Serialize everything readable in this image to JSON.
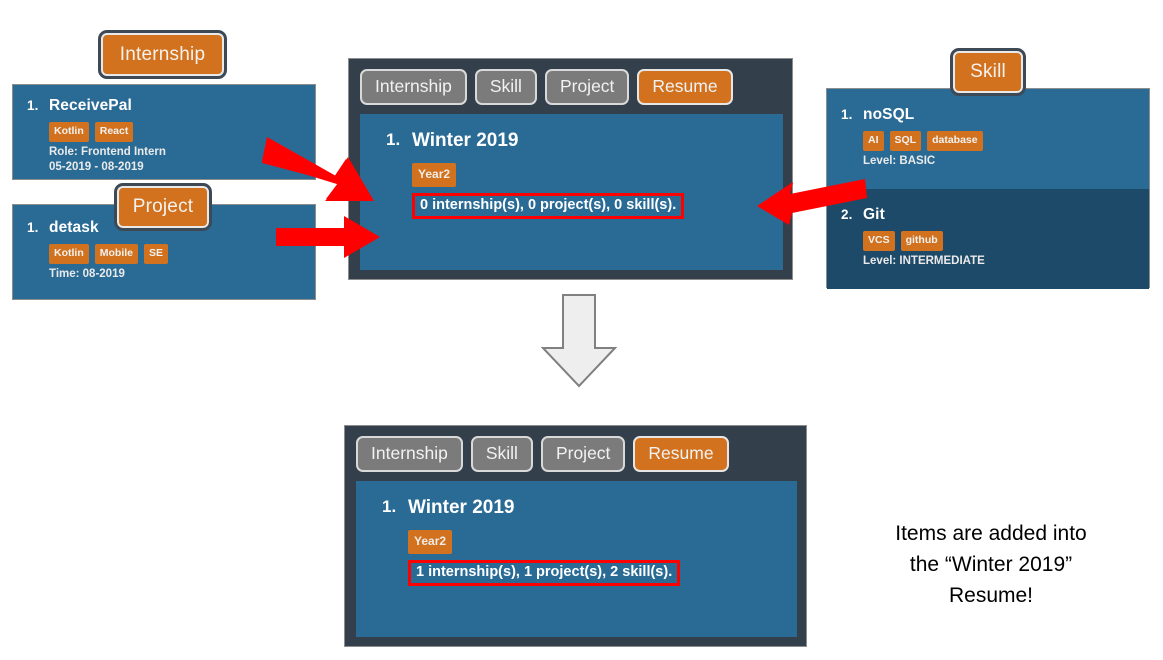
{
  "app": {
    "tabs": [
      "Internship",
      "Skill",
      "Project",
      "Resume"
    ],
    "active_tab": "Resume"
  },
  "colors": {
    "panel_blue": "#2a6b96",
    "panel_blue_dark": "#1d4a68",
    "accent_orange": "#d2721f",
    "tab_gray": "#7b7b7b",
    "tabbar_dark": "#333f4a",
    "highlight_red": "#ff0000",
    "arrow_red": "#ff0000",
    "flow_arrow_gray": "#eeeeee"
  },
  "internship_panel": {
    "chip_label": "Internship",
    "items": [
      {
        "number": "1.",
        "title": "ReceivePal",
        "tags": [
          "Kotlin",
          "React"
        ],
        "meta_line1": "Role: Frontend Intern",
        "meta_line2": "05-2019 - 08-2019"
      }
    ]
  },
  "project_panel": {
    "chip_label": "Project",
    "items": [
      {
        "number": "1.",
        "title": "detask",
        "tags": [
          "Kotlin",
          "Mobile",
          "SE"
        ],
        "meta_line1": "Time: 08-2019",
        "meta_line2": ""
      }
    ]
  },
  "skill_panel": {
    "chip_label": "Skill",
    "items": [
      {
        "number": "1.",
        "title": "noSQL",
        "tags": [
          "AI",
          "SQL",
          "database"
        ],
        "meta_line1": "Level: BASIC",
        "meta_line2": ""
      },
      {
        "number": "2.",
        "title": "Git",
        "tags": [
          "VCS",
          "github"
        ],
        "meta_line1": "Level: INTERMEDIATE",
        "meta_line2": ""
      }
    ]
  },
  "resume_before": {
    "tabs": [
      "Internship",
      "Skill",
      "Project",
      "Resume"
    ],
    "active_tab": "Resume",
    "item": {
      "number": "1.",
      "title": "Winter 2019",
      "tag": "Year2",
      "summary": "0 internship(s), 0 project(s), 0 skill(s)."
    }
  },
  "resume_after": {
    "tabs": [
      "Internship",
      "Skill",
      "Project",
      "Resume"
    ],
    "active_tab": "Resume",
    "item": {
      "number": "1.",
      "title": "Winter 2019",
      "tag": "Year2",
      "summary": "1 internship(s), 1 project(s), 2 skill(s)."
    }
  },
  "caption": {
    "line1": "Items are added into",
    "line2": "the “Winter 2019”",
    "line3": "Resume!"
  },
  "arrows": {
    "internship_to_resume": "red-arrow-down-right",
    "project_to_resume": "red-arrow-right",
    "skill_to_resume": "red-arrow-left",
    "flow_down": "gray-block-arrow-down"
  }
}
